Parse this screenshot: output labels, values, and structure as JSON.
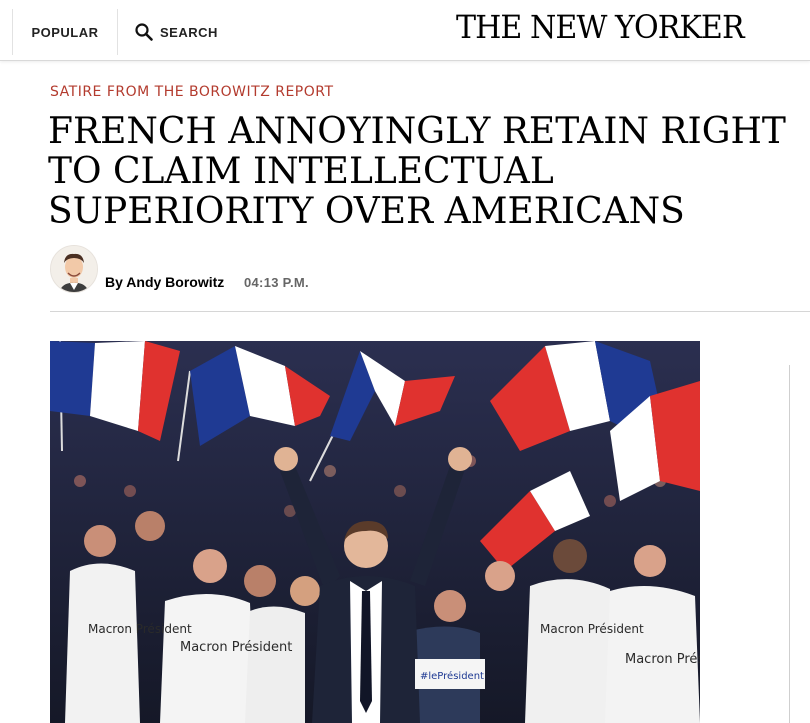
{
  "nav": {
    "popular_label": "POPULAR",
    "search_label": "SEARCH"
  },
  "masthead": "THE NEW YORKER",
  "article": {
    "kicker": "SATIRE FROM THE BOROWITZ REPORT",
    "headline": "FRENCH ANNOYINGLY RETAIN RIGHT TO CLAIM INTELLECTUAL SUPERIORITY OVER AMERICANS",
    "byline_prefix": "By",
    "author": "Andy Borowitz",
    "time": "04:13 P.M."
  },
  "photo": {
    "shirt_text": "Macron Président",
    "sign_text": "#lePrésident"
  },
  "colors": {
    "kicker": "#b33b2e",
    "flag_blue": "#1f3a93",
    "flag_red": "#e0322f",
    "flag_white": "#ffffff"
  },
  "icons": [
    "search-icon",
    "author-avatar"
  ]
}
